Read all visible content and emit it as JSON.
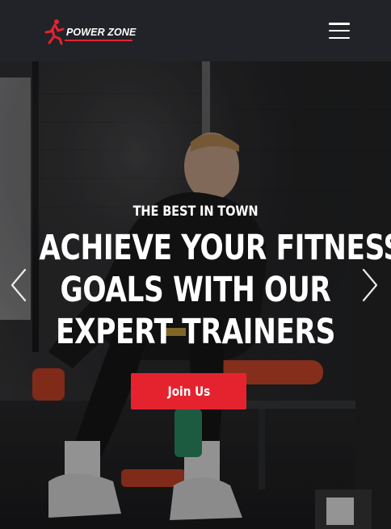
{
  "brand": {
    "name": "POWER ZONE",
    "accent": "#e5232f",
    "header_bg": "#212328"
  },
  "nav": {
    "menu_icon": "hamburger-menu-icon"
  },
  "hero": {
    "eyebrow": "THE BEST IN TOWN",
    "headline_lines": [
      "ACHIEVE YOUR FITNESS",
      "GOALS WITH OUR",
      "EXPERT TRAINERS"
    ],
    "cta_label": "Join Us",
    "prev_icon": "chevron-left-icon",
    "next_icon": "chevron-right-icon"
  }
}
